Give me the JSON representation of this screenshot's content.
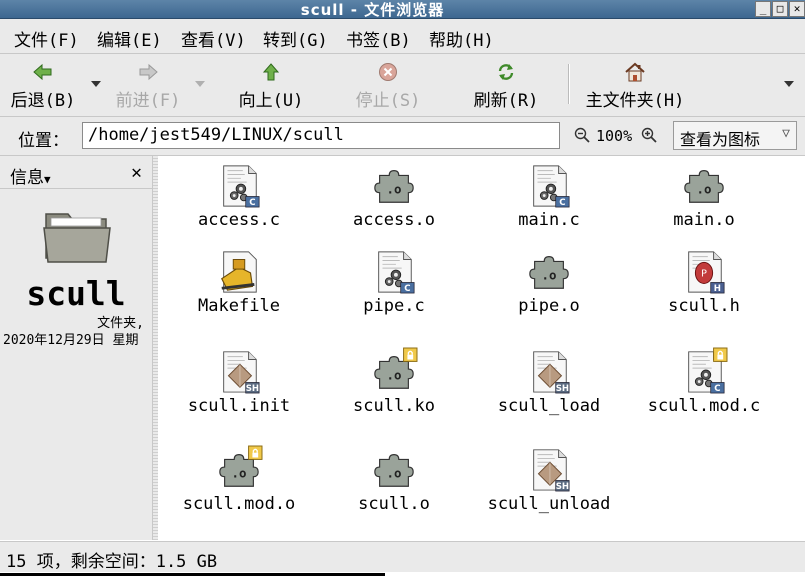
{
  "window": {
    "title": "scull - 文件浏览器"
  },
  "menubar": {
    "items": [
      {
        "label": "文件(F)"
      },
      {
        "label": "编辑(E)"
      },
      {
        "label": "查看(V)"
      },
      {
        "label": "转到(G)"
      },
      {
        "label": "书签(B)"
      },
      {
        "label": "帮助(H)"
      }
    ]
  },
  "toolbar": {
    "back": "后退(B)",
    "forward": "前进(F)",
    "up": "向上(U)",
    "stop": "停止(S)",
    "reload": "刷新(R)",
    "home": "主文件夹(H)"
  },
  "location": {
    "label": "位置：",
    "path": "/home/jest549/LINUX/scull",
    "zoom": "100%",
    "view_mode": "查看为图标"
  },
  "sidepane": {
    "title": "信息",
    "folder_name": "scull",
    "folder_type": "文件夹,",
    "modified": "2020年12月29日 星期"
  },
  "files": [
    {
      "name": "access.c",
      "icon": "c-source-icon"
    },
    {
      "name": "access.o",
      "icon": "object-file-icon"
    },
    {
      "name": "main.c",
      "icon": "c-source-icon"
    },
    {
      "name": "main.o",
      "icon": "object-file-icon"
    },
    {
      "name": "Makefile",
      "icon": "makefile-icon"
    },
    {
      "name": "pipe.c",
      "icon": "c-source-icon"
    },
    {
      "name": "pipe.o",
      "icon": "object-file-icon"
    },
    {
      "name": "scull.h",
      "icon": "c-header-icon"
    },
    {
      "name": "scull.init",
      "icon": "shell-script-icon"
    },
    {
      "name": "scull.ko",
      "icon": "object-file-locked-icon"
    },
    {
      "name": "scull_load",
      "icon": "shell-script-icon"
    },
    {
      "name": "scull.mod.c",
      "icon": "c-source-locked-icon"
    },
    {
      "name": "scull.mod.o",
      "icon": "object-file-locked-icon"
    },
    {
      "name": "scull.o",
      "icon": "object-file-icon"
    },
    {
      "name": "scull_unload",
      "icon": "shell-script-icon"
    }
  ],
  "status": {
    "text": "15 项，剩余空间：1.5 GB"
  },
  "colors": {
    "titlebar": "#4a7399",
    "chrome": "#eaeaea",
    "content": "#ffffff"
  }
}
